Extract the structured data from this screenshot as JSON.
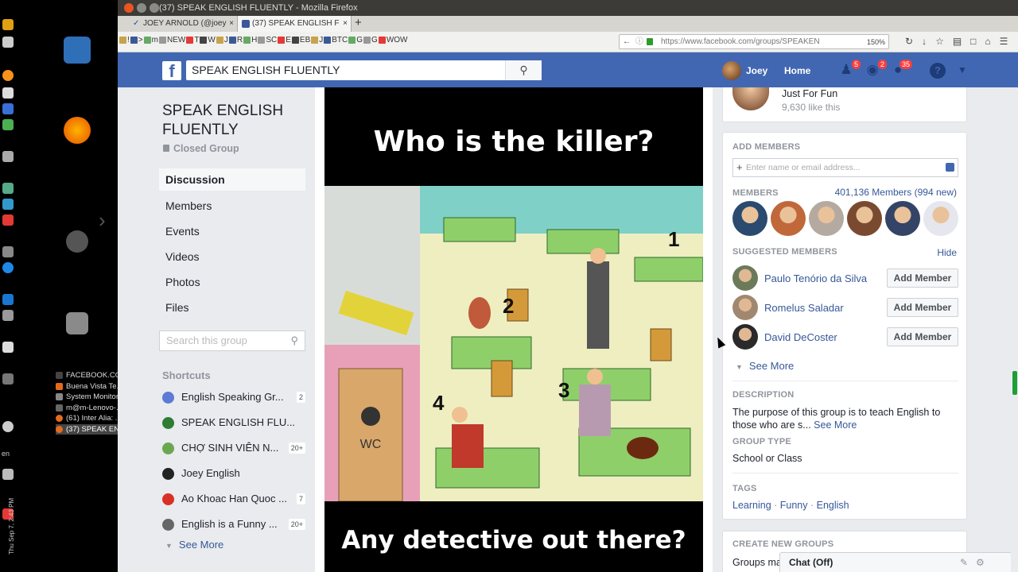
{
  "window": {
    "title": "(37) SPEAK ENGLISH FLUENTLY - Mozilla Firefox",
    "tabs": [
      {
        "label": "JOEY ARNOLD (@joey"
      },
      {
        "label": "(37) SPEAK ENGLISH F"
      }
    ],
    "bookmarks": [
      "!",
      ">",
      "m",
      "NEW",
      "T",
      "W",
      "J",
      "R",
      "H",
      "SC",
      "E",
      "EB",
      "J",
      "BTC",
      "G",
      "G",
      "WOW"
    ],
    "url": "https://www.facebook.com/groups/SPEAKEN",
    "zoom": "150%"
  },
  "desktop": {
    "taskbar": [
      {
        "label": "FACEBOOK.COM",
        "color": "#444444"
      },
      {
        "label": "Buena Vista Te...",
        "color": "#e36a1c"
      },
      {
        "label": "System Monitor",
        "color": "#888888"
      },
      {
        "label": "m@m-Lenovo-...",
        "color": "#666666"
      },
      {
        "label": "(61) Inter Alia: ...",
        "color": "#e36a1c"
      },
      {
        "label": "(37) SPEAK EN...",
        "color": "#e36a1c"
      }
    ],
    "lang": "en",
    "clock": "Thu Sep 7, 2:43 PM"
  },
  "fb": {
    "search_value": "SPEAK ENGLISH FLUENTLY",
    "user": "Joey",
    "home": "Home",
    "badges": {
      "friends": "5",
      "messages": "2",
      "notifications": "35"
    },
    "help": "?"
  },
  "group": {
    "name": "SPEAK ENGLISH FLUENTLY",
    "type": "Closed Group",
    "nav": [
      "Discussion",
      "Members",
      "Events",
      "Videos",
      "Photos",
      "Files"
    ],
    "search_placeholder": "Search this group",
    "shortcuts_heading": "Shortcuts",
    "shortcuts": [
      {
        "label": "English Speaking Gr...",
        "count": "2",
        "color": "#5b7bd5"
      },
      {
        "label": "SPEAK ENGLISH FLU...",
        "count": "",
        "color": "#2e7d32"
      },
      {
        "label": "CHỢ SINH VIÊN N...",
        "count": "20+",
        "color": "#6aa84f"
      },
      {
        "label": "Joey English",
        "count": "",
        "color": "#222222"
      },
      {
        "label": "Ao Khoac Han Quoc ...",
        "count": "7",
        "color": "#d93025"
      },
      {
        "label": "English is a Funny ...",
        "count": "20+",
        "color": "#666666"
      }
    ],
    "see_more": "See More"
  },
  "post": {
    "question_top": "Who is the killer?",
    "question_bottom": "Any detective out there?",
    "scene_numbers": [
      "1",
      "2",
      "3",
      "4"
    ],
    "scene_sign": "WC"
  },
  "right": {
    "page": {
      "name": "Just For Fun",
      "likes": "9,630 like this"
    },
    "add_members_heading": "ADD MEMBERS",
    "add_members_placeholder": "Enter name or email address...",
    "members_heading": "MEMBERS",
    "members_count": "401,136 Members (994 new)",
    "member_avatar_colors": [
      "#2b4a6f",
      "#c0683a",
      "#b5aaa0",
      "#7a4a30",
      "#334466",
      "#e6e6ee"
    ],
    "suggested_heading": "SUGGESTED MEMBERS",
    "hide": "Hide",
    "suggested": [
      {
        "name": "Paulo Tenório da Silva",
        "button": "Add Member",
        "color": "#6b7b5a"
      },
      {
        "name": "Romelus Saladar",
        "button": "Add Member",
        "color": "#a08870"
      },
      {
        "name": "David DeCoster",
        "button": "Add Member",
        "color": "#2a2a2a"
      }
    ],
    "see_more": "See More",
    "description_heading": "DESCRIPTION",
    "description": "The purpose of this group is to teach English to those who are s...",
    "description_more": "See More",
    "group_type_heading": "GROUP TYPE",
    "group_type": "School or Class",
    "tags_heading": "TAGS",
    "tags": [
      "Learning",
      "Funny",
      "English"
    ],
    "create_heading": "CREATE NEW GROUPS",
    "create_text": "Groups ma",
    "chat": "Chat (Off)"
  }
}
